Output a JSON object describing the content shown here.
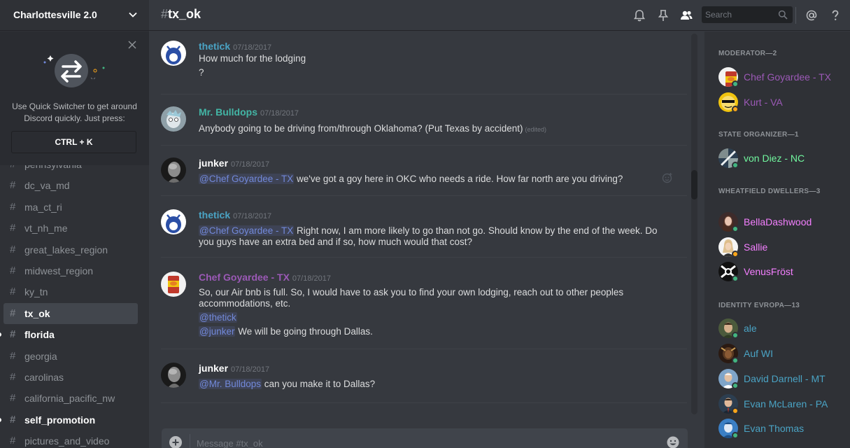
{
  "sidebar": {
    "server_name": "Charlottesville 2.0",
    "switcher": {
      "text": "Use Quick Switcher to get around Discord quickly. Just press:",
      "shortcut": "CTRL + K"
    },
    "channels": [
      {
        "name": "pennsylvania",
        "state": "normal"
      },
      {
        "name": "dc_va_md",
        "state": "normal"
      },
      {
        "name": "ma_ct_ri",
        "state": "normal"
      },
      {
        "name": "vt_nh_me",
        "state": "normal"
      },
      {
        "name": "great_lakes_region",
        "state": "normal"
      },
      {
        "name": "midwest_region",
        "state": "normal"
      },
      {
        "name": "ky_tn",
        "state": "normal"
      },
      {
        "name": "tx_ok",
        "state": "active"
      },
      {
        "name": "florida",
        "state": "unread"
      },
      {
        "name": "georgia",
        "state": "normal"
      },
      {
        "name": "carolinas",
        "state": "normal"
      },
      {
        "name": "california_pacific_nw",
        "state": "normal"
      },
      {
        "name": "self_promotion",
        "state": "unread"
      },
      {
        "name": "pictures_and_video",
        "state": "normal"
      }
    ]
  },
  "header": {
    "hash": "#",
    "channel": "tx_ok",
    "search_placeholder": "Search",
    "icons": [
      "bell-icon",
      "pin-icon",
      "members-icon",
      "search-icon",
      "mention-icon",
      "help-icon"
    ]
  },
  "messages": [
    {
      "author": "thetick",
      "author_color": "#4aa3c4",
      "timestamp": "07/18/2017",
      "lines": [
        {
          "text": "How much for the lodging"
        },
        {
          "text": "?"
        }
      ]
    },
    {
      "author": "Mr. Bulldops",
      "author_color": "#43b5a5",
      "timestamp": "07/18/2017",
      "lines": [
        {
          "text": "Anybody going to be driving from/through Oklahoma? (Put Texas by accident)",
          "edited": "(edited)"
        }
      ]
    },
    {
      "author": "junker",
      "author_color": "#ffffff",
      "timestamp": "07/18/2017",
      "lines": [
        {
          "mention": "@Chef Goyardee - TX",
          "text": " we've got a goy here in OKC who needs a ride. How far north are you driving?"
        }
      ]
    },
    {
      "author": "thetick",
      "author_color": "#4aa3c4",
      "timestamp": "07/18/2017",
      "lines": [
        {
          "mention": "@Chef Goyardee - TX",
          "text": " Right now, I am more likely to go than not go. Should know by the end of the week. Do you guys have an extra bed and if so, how much would that cost?"
        }
      ]
    },
    {
      "author": "Chef Goyardee - TX",
      "author_color": "#9b59b6",
      "timestamp": "07/18/2017",
      "lines": [
        {
          "text": "So, our Air bnb is full. So, I would have to ask you to find your own lodging, reach out to other peoples accommodations, etc."
        },
        {
          "mention": "@thetick",
          "text": ""
        },
        {
          "mention": "@junker",
          "text": " We will be going through Dallas."
        }
      ]
    },
    {
      "author": "junker",
      "author_color": "#ffffff",
      "timestamp": "07/18/2017",
      "lines": [
        {
          "mention": "@Mr. Bulldops",
          "text": " can you make it to Dallas?"
        }
      ]
    }
  ],
  "composer": {
    "placeholder": "Message #tx_ok"
  },
  "members": {
    "groups": [
      {
        "role": "MODERATOR—2",
        "members": [
          {
            "name": "Chef Goyardee - TX",
            "color": "#9b59b6",
            "status": "online"
          },
          {
            "name": "Kurt - VA",
            "color": "#9b59b6",
            "status": "idle"
          }
        ]
      },
      {
        "role": "STATE ORGANIZER—1",
        "members": [
          {
            "name": "von Diez - NC",
            "color": "#71f79f",
            "status": "online"
          }
        ]
      },
      {
        "role": "WHEATFIELD DWELLERS—3",
        "members": [
          {
            "name": "BellaDashwood",
            "color": "#f47fff",
            "status": "online"
          },
          {
            "name": "Sallie",
            "color": "#f47fff",
            "status": "idle"
          },
          {
            "name": "VenusFröst",
            "color": "#f47fff",
            "status": "online"
          }
        ]
      },
      {
        "role": "IDENTITY EVROPA—13",
        "members": [
          {
            "name": "ale",
            "color": "#4aa3c4",
            "status": "online"
          },
          {
            "name": "Auf WI",
            "color": "#4aa3c4",
            "status": "online"
          },
          {
            "name": "David Darnell - MT",
            "color": "#4aa3c4",
            "status": "online"
          },
          {
            "name": "Evan McLaren - PA",
            "color": "#4aa3c4",
            "status": "idle"
          },
          {
            "name": "Evan Thomas",
            "color": "#4aa3c4",
            "status": "online"
          }
        ]
      }
    ]
  },
  "colors": {
    "online": "#43b581",
    "idle": "#faa61a",
    "mention": "#7289da",
    "background": "#36393f",
    "sidebar": "#2f3136"
  }
}
